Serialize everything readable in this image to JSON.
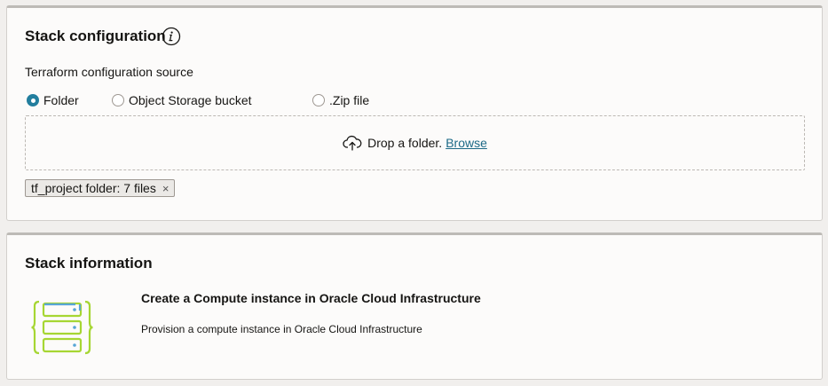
{
  "config_panel": {
    "title": "Stack configuration",
    "info_icon": "info-icon",
    "source_label": "Terraform configuration source",
    "source_options": [
      {
        "label": "Folder",
        "selected": true
      },
      {
        "label": "Object Storage bucket",
        "selected": false
      },
      {
        "label": ".Zip file",
        "selected": false
      }
    ],
    "dropzone": {
      "icon": "cloud-upload-icon",
      "prompt": "Drop a folder.",
      "browse_label": "Browse"
    },
    "uploaded_chip": {
      "label": "tf_project folder: 7 files",
      "remove_glyph": "×"
    }
  },
  "info_panel": {
    "title": "Stack information",
    "icon": "server-stack-icon",
    "stack_name": "Create a Compute instance in Oracle Cloud Infrastructure",
    "stack_description": "Provision a compute instance in Oracle Cloud Infrastructure"
  },
  "colors": {
    "accent": "#227e9e",
    "link": "#1d6a87",
    "icon_green": "#a6d633",
    "icon_blue": "#58a6d6"
  }
}
